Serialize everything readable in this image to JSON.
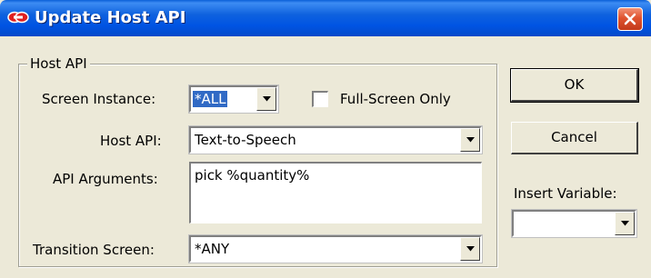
{
  "window": {
    "title": "Update Host API",
    "app_icon": "link-icon",
    "close_icon": "close-icon"
  },
  "group": {
    "label": "Host API"
  },
  "screen_instance": {
    "label": "Screen Instance:",
    "value": "*ALL"
  },
  "full_screen_only": {
    "label": "Full-Screen Only",
    "checked": false
  },
  "host_api": {
    "label": "Host API:",
    "value": "Text-to-Speech"
  },
  "api_arguments": {
    "label": "API Arguments:",
    "value": "pick %quantity%"
  },
  "transition_screen": {
    "label": "Transition Screen:",
    "value": "*ANY"
  },
  "buttons": {
    "ok": "OK",
    "cancel": "Cancel"
  },
  "insert_variable": {
    "label": "Insert Variable:",
    "value": ""
  },
  "colors": {
    "titlebar": "#0054e3",
    "dialog_bg": "#ece9d8",
    "close": "#e0532f",
    "selection": "#316ac5"
  }
}
